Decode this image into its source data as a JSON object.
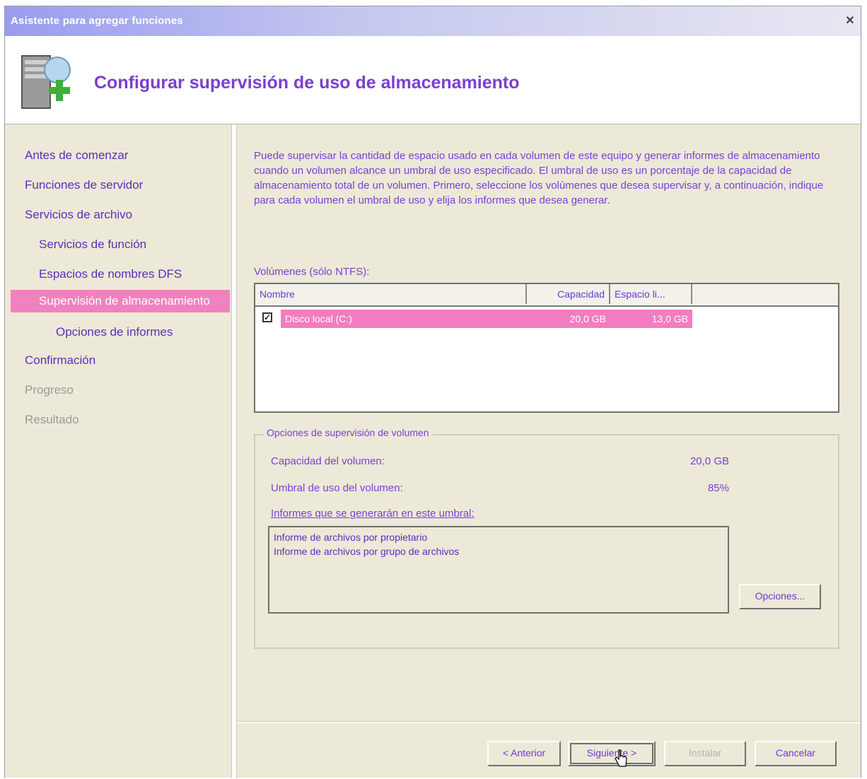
{
  "window": {
    "title": "Asistente para agregar funciones",
    "close_symbol": "✕"
  },
  "header": {
    "title": "Configurar supervisión de uso de almacenamiento",
    "icon": "server-add-icon"
  },
  "sidebar": {
    "items": [
      {
        "label": "Antes de comenzar",
        "state": "normal"
      },
      {
        "label": "Funciones de servidor",
        "state": "normal"
      },
      {
        "label": "Servicios de archivo",
        "state": "normal"
      },
      {
        "label": "Servicios de función",
        "state": "normal"
      },
      {
        "label": "Espacios de nombres DFS",
        "state": "normal"
      },
      {
        "label": "Supervisión de almacenamiento",
        "state": "selected"
      },
      {
        "label": "Opciones de informes",
        "state": "normal"
      },
      {
        "label": "Confirmación",
        "state": "normal"
      },
      {
        "label": "Progreso",
        "state": "disabled"
      },
      {
        "label": "Resultado",
        "state": "disabled"
      }
    ]
  },
  "main": {
    "description": "Puede supervisar la cantidad de espacio usado en cada volumen de este equipo y generar informes de almacenamiento cuando un volumen alcance un umbral de uso especificado. El umbral de uso es un porcentaje de la capacidad de almacenamiento total de un volumen. Primero, seleccione los volúmenes que desea supervisar y, a continuación, indique para cada volumen el umbral de uso y elija los informes que desea generar.",
    "volumes_label": "Volúmenes (sólo NTFS):",
    "volumes_table": {
      "columns": [
        "Nombre",
        "Capacidad",
        "Espacio li..."
      ],
      "rows": [
        {
          "checked": true,
          "name": "Disco local (C:)",
          "capacity": "20,0 GB",
          "free": "13,0 GB"
        }
      ]
    },
    "options_group": {
      "legend": "Opciones de supervisión de volumen",
      "capacity_label": "Capacidad del volumen:",
      "capacity_value": "20,0 GB",
      "threshold_label": "Umbral de uso del volumen:",
      "threshold_value": "85%",
      "reports_label": "Informes que se generarán en este umbral:",
      "reports": [
        "Informe de archivos por propietario",
        "Informe de archivos por grupo de archivos"
      ],
      "options_button": "Opciones..."
    }
  },
  "footer": {
    "back_button": "< Anterior",
    "next_button": "Siguiente >",
    "install_button": "Instalar",
    "cancel_button": "Cancelar"
  },
  "colors": {
    "accent_text": "#7b3fd6",
    "selection": "#f082bf",
    "title_gradient_start": "#9a9cf0"
  }
}
